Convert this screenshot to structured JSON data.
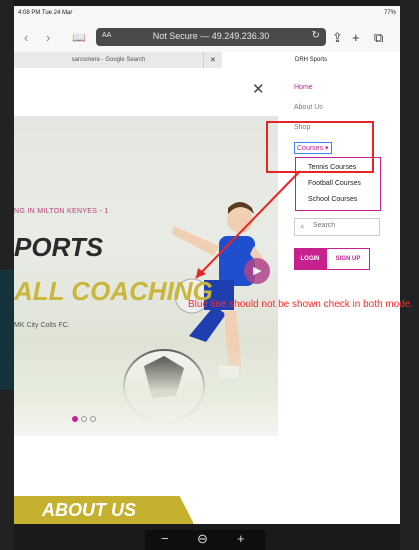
{
  "status_bar": {
    "time": "4:08 PM  Tue 24 Mar",
    "battery": "77%"
  },
  "toolbar": {
    "back_icon": "chevron-left-icon",
    "forward_icon": "chevron-right-icon",
    "aa": "AA",
    "url": "Not Secure — 49.249.236.30",
    "icons": [
      "book-icon",
      "reload-icon",
      "share-icon",
      "plus-icon",
      "tabs-icon"
    ]
  },
  "tabs": [
    {
      "label": "sarcomere - Google Search"
    },
    {
      "label": "DRH Sports"
    }
  ],
  "hero": {
    "kicker": "NG IN MILTON KENYES - 1",
    "heading_1": "PORTS",
    "heading_2": "ALL COACHING",
    "subtext": "MK City Colts FC.",
    "next_label": "▶"
  },
  "about_banner": "ABOUT US",
  "menu": {
    "home": "Home",
    "about": "About Us",
    "shop": "Shop",
    "courses": "Courses",
    "submenu": [
      "Tennis Courses",
      "Football Courses",
      "School Courses"
    ],
    "search_placeholder": "Search",
    "login": "LOGIN",
    "signup": "SIGN UP"
  },
  "annotation": {
    "text": "Blue line should not be shown check in both mode.",
    "color": "#e82525"
  },
  "zoom": {
    "minus": "−",
    "reset": "⊖",
    "plus": "+"
  },
  "colors": {
    "accent": "#c7218e",
    "gold": "#c9b63a"
  }
}
